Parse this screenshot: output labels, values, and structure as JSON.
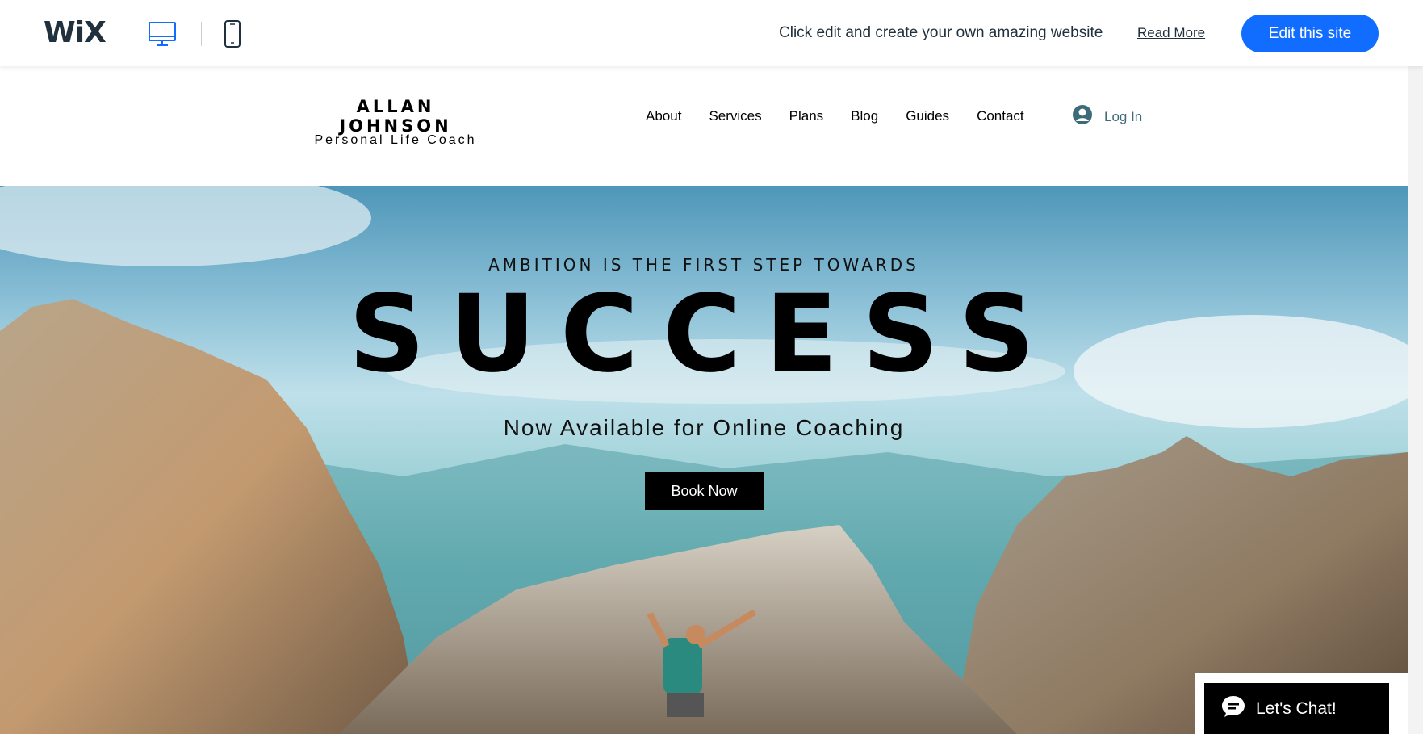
{
  "wix_bar": {
    "logo": "WiX",
    "promo_text": "Click edit and create your own amazing website",
    "read_more": "Read More",
    "edit_button": "Edit this site"
  },
  "site": {
    "brand_name": "ALLAN JOHNSON",
    "brand_subtitle": "Personal Life Coach",
    "nav": [
      "About",
      "Services",
      "Plans",
      "Blog",
      "Guides",
      "Contact"
    ],
    "login_label": "Log In"
  },
  "hero": {
    "tagline": "AMBITION IS THE FIRST STEP TOWARDS",
    "title": "SUCCESS",
    "subtitle": "Now Available for Online Coaching",
    "cta": "Book Now"
  },
  "chat": {
    "label": "Let's Chat!"
  },
  "colors": {
    "wix_blue": "#116dff",
    "dark_text": "#20303c",
    "login_accent": "#3d6b7a"
  }
}
